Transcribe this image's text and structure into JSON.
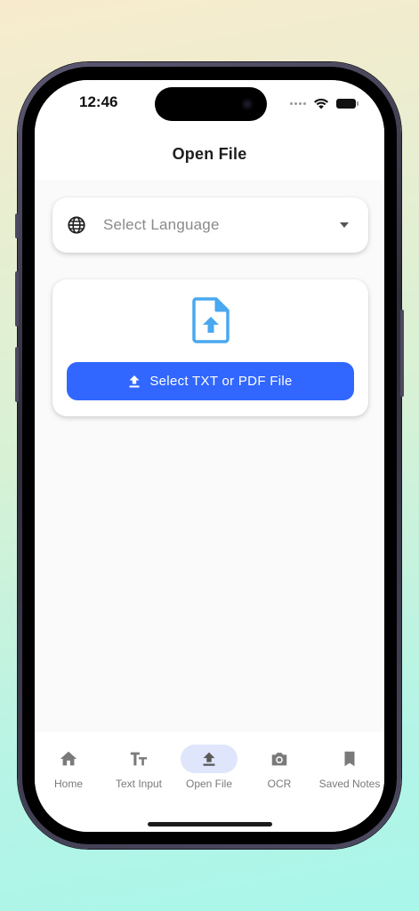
{
  "status_bar": {
    "time": "12:46"
  },
  "app_bar": {
    "title": "Open File"
  },
  "language_select": {
    "placeholder": "Select Language",
    "icon": "globe-icon"
  },
  "file_card": {
    "icon": "file-upload-icon",
    "button_label": "Select TXT or PDF File",
    "button_icon": "upload-icon",
    "accent": "#3267ff"
  },
  "bottom_nav": {
    "items": [
      {
        "label": "Home",
        "icon": "home-icon",
        "active": false
      },
      {
        "label": "Text Input",
        "icon": "text-fields-icon",
        "active": false
      },
      {
        "label": "Open File",
        "icon": "upload-icon",
        "active": true
      },
      {
        "label": "OCR",
        "icon": "camera-icon",
        "active": false
      },
      {
        "label": "Saved Notes",
        "icon": "bookmark-icon",
        "active": false
      }
    ]
  }
}
